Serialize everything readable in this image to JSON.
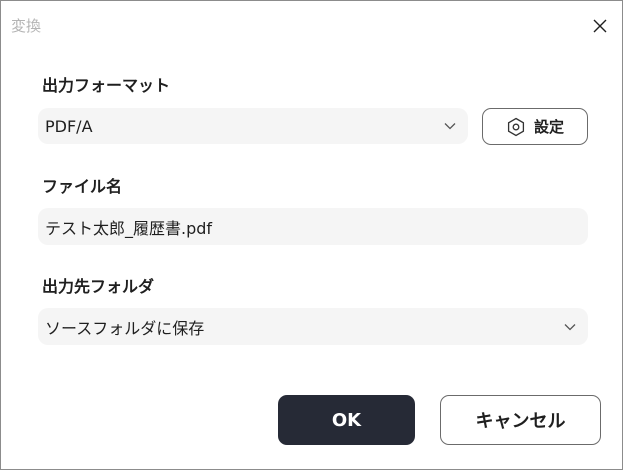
{
  "dialog": {
    "title": "変換",
    "close_icon": "close-icon"
  },
  "output_format": {
    "label": "出力フォーマット",
    "value": "PDF/A",
    "settings_label": "設定",
    "settings_icon": "gear-icon"
  },
  "file_name": {
    "label": "ファイル名",
    "value": "テスト太郎_履歴書.pdf"
  },
  "output_folder": {
    "label": "出力先フォルダ",
    "value": "ソースフォルダに保存"
  },
  "buttons": {
    "ok_label": "OK",
    "cancel_label": "キャンセル"
  },
  "colors": {
    "primary_button": "#262a36",
    "field_background": "#f5f5f5"
  }
}
